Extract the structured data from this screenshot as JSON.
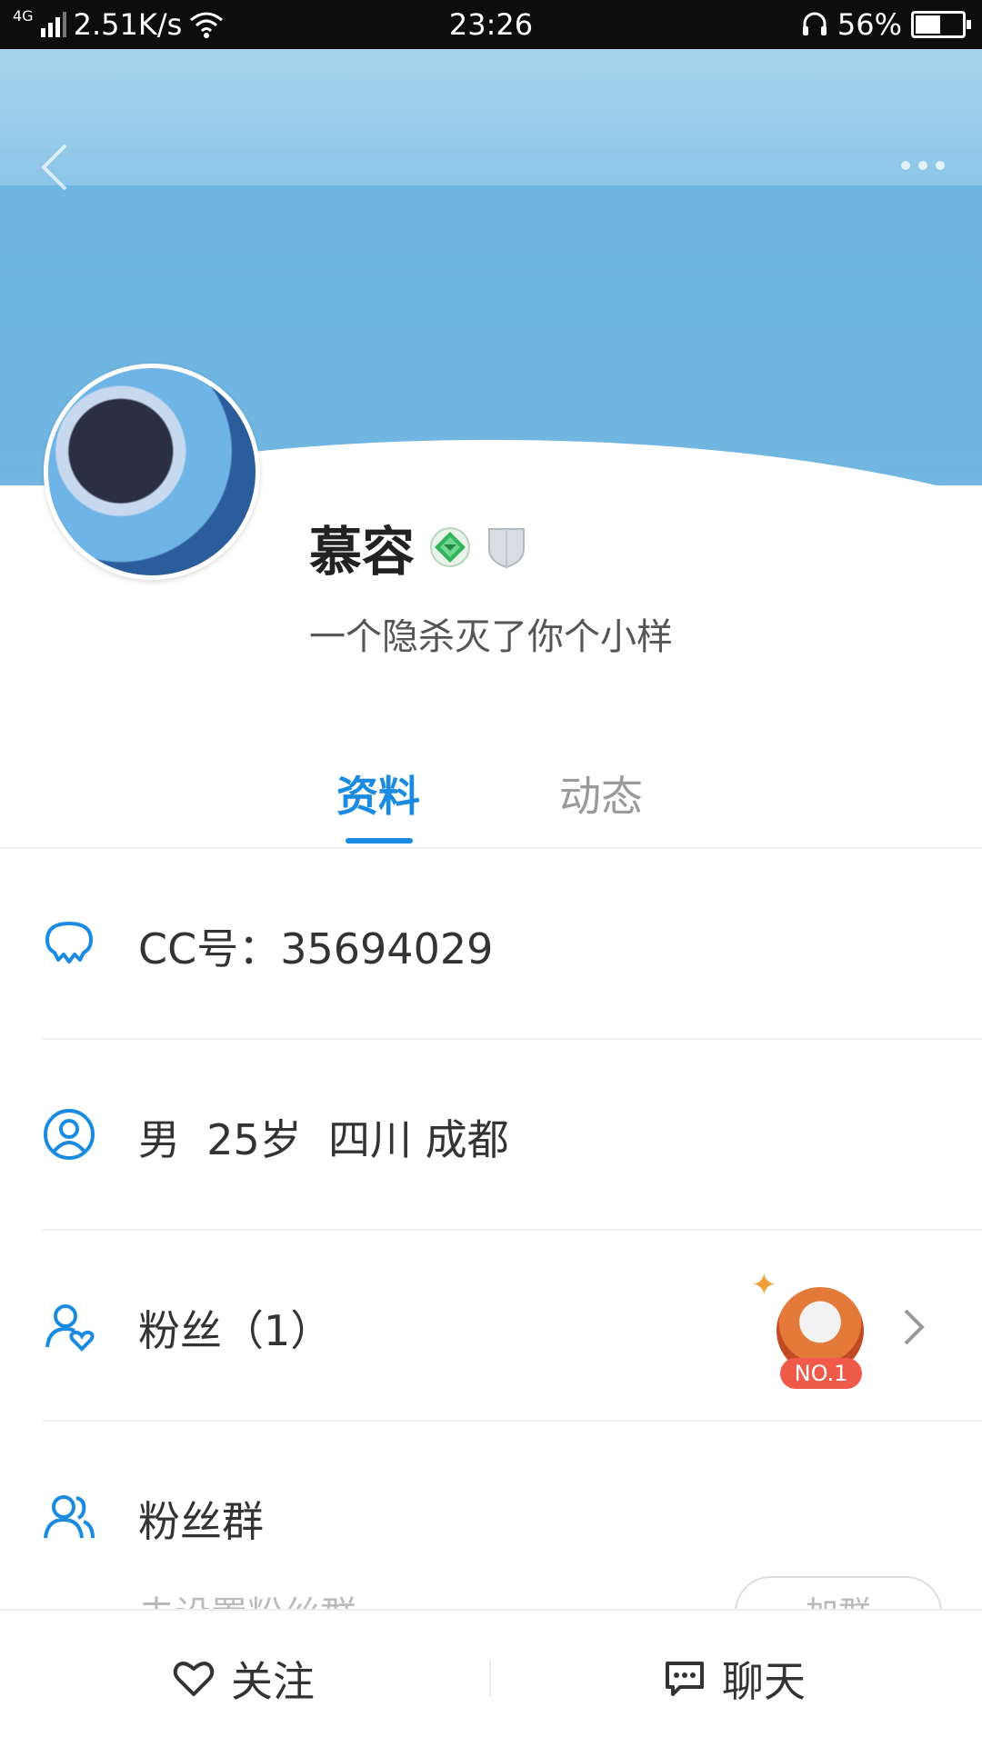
{
  "status_bar": {
    "network": "4G",
    "speed": "2.51K/s",
    "time": "23:26",
    "battery": "56%",
    "battery_level": 0.56
  },
  "header": {
    "back_icon": "chevron-left-icon",
    "more_icon": "more-dots-icon"
  },
  "profile": {
    "name": "慕容",
    "signature": "一个隐杀灭了你个小样"
  },
  "tabs": [
    {
      "label": "资料",
      "active": true
    },
    {
      "label": "动态",
      "active": false
    }
  ],
  "info": {
    "cc_number": "CC号：35694029",
    "basic": "男  25岁  四川 成都",
    "fans": "粉丝（1）",
    "fan_badge": "NO.1",
    "fan_group": "粉丝群",
    "fan_group_hint": "未设置粉丝群",
    "join_button": "加群"
  },
  "bottom_bar": {
    "follow": "关注",
    "chat": "聊天"
  },
  "colors": {
    "accent": "#1a8be0",
    "status_bar": "#0d0d0d"
  }
}
